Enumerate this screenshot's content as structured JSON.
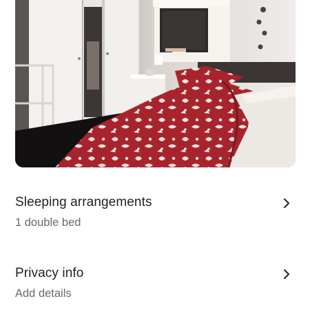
{
  "photo": {
    "icon": "bedroom-photo"
  },
  "sleeping": {
    "title": "Sleeping arrangements",
    "subtitle": "1 double bed",
    "chevron_icon": "chevron-right-icon"
  },
  "privacy": {
    "title": "Privacy info",
    "subtitle": "Add details",
    "chevron_icon": "chevron-right-icon"
  },
  "colors": {
    "text_primary": "#222222",
    "text_secondary": "#6a6a6a",
    "duvet_red": "#a8242c"
  }
}
